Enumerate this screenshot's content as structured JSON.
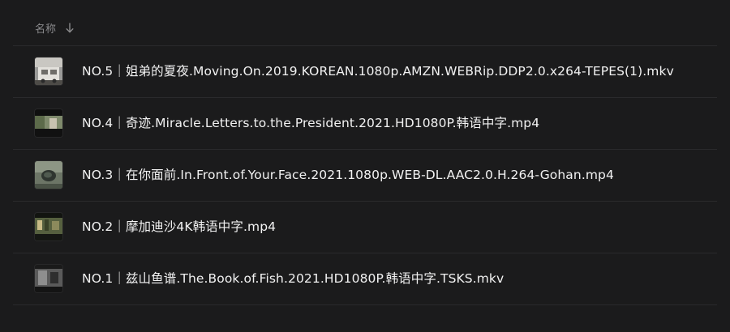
{
  "header": {
    "name_label": "名称",
    "sort_icon": "arrow-down-icon"
  },
  "files": [
    {
      "name": "NO.5｜姐弟的夏夜.Moving.On.2019.KOREAN.1080p.AMZN.WEBRip.DDP2.0.x264-TEPES(1).mkv",
      "thumb_icon": "video-thumbnail"
    },
    {
      "name": "NO.4｜奇迹.Miracle.Letters.to.the.President.2021.HD1080P.韩语中字.mp4",
      "thumb_icon": "video-thumbnail"
    },
    {
      "name": "NO.3｜在你面前.In.Front.of.Your.Face.2021.1080p.WEB-DL.AAC2.0.H.264-Gohan.mp4",
      "thumb_icon": "video-thumbnail"
    },
    {
      "name": "NO.2｜摩加迪沙4K韩语中字.mp4",
      "thumb_icon": "video-thumbnail"
    },
    {
      "name": "NO.1｜兹山鱼谱.The.Book.of.Fish.2021.HD1080P.韩语中字.TSKS.mkv",
      "thumb_icon": "video-thumbnail"
    }
  ]
}
